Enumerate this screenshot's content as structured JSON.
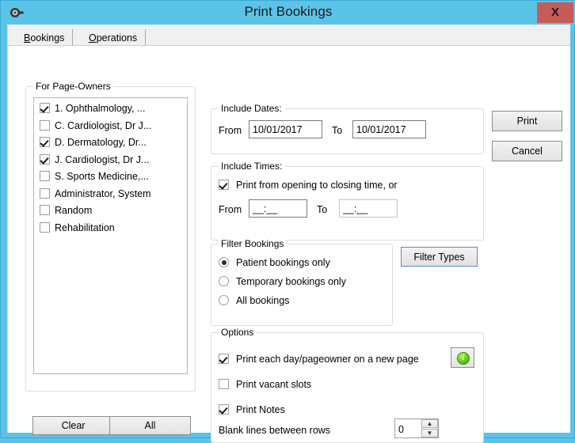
{
  "window": {
    "title": "Print Bookings",
    "icon": "binoculars-icon",
    "close_label": "X",
    "titlebar_color": "#5bc3e8",
    "close_color": "#c75b56"
  },
  "tabs": [
    {
      "label": "Bookings",
      "accelerator": "B",
      "active": true
    },
    {
      "label": "Operations",
      "accelerator": "O",
      "active": false
    }
  ],
  "page_owners": {
    "group_title": "For Page-Owners",
    "items": [
      {
        "label": "1. Ophthalmology, ...",
        "checked": true
      },
      {
        "label": "C. Cardiologist, Dr J...",
        "checked": false
      },
      {
        "label": "D. Dermatology, Dr...",
        "checked": true
      },
      {
        "label": "J. Cardiologist, Dr J...",
        "checked": true
      },
      {
        "label": "S. Sports Medicine,...",
        "checked": false
      },
      {
        "label": "Administrator, System",
        "checked": false
      },
      {
        "label": "Random",
        "checked": false
      },
      {
        "label": "Rehabilitation",
        "checked": false
      }
    ],
    "clear_label": "Clear",
    "all_label": "All"
  },
  "include_dates": {
    "group_title": "Include Dates:",
    "from_label": "From",
    "from_value": "10/01/2017",
    "to_label": "To",
    "to_value": "10/01/2017"
  },
  "include_times": {
    "group_title": "Include Times:",
    "opening_closing_label": "Print from opening to closing time, or",
    "opening_closing_checked": true,
    "from_label": "From",
    "from_value": "__:__",
    "to_label": "To",
    "to_value": "__:__"
  },
  "filter_bookings": {
    "group_title": "Filter Bookings",
    "options": [
      {
        "label": "Patient bookings only",
        "selected": true
      },
      {
        "label": "Temporary bookings only",
        "selected": false
      },
      {
        "label": "All bookings",
        "selected": false
      }
    ],
    "filter_types_label": "Filter Types"
  },
  "options": {
    "group_title": "Options",
    "checkboxes": [
      {
        "label": "Print each day/pageowner on a new page",
        "checked": true
      },
      {
        "label": "Print vacant slots",
        "checked": false
      },
      {
        "label": "Print Notes",
        "checked": true
      }
    ],
    "info_icon": "info-icon",
    "info_glyph": "i",
    "blank_lines_label": "Blank lines between rows",
    "blank_lines_value": "0",
    "spin_up": "▲",
    "spin_down": "▼"
  },
  "actions": {
    "print_label": "Print",
    "cancel_label": "Cancel"
  }
}
